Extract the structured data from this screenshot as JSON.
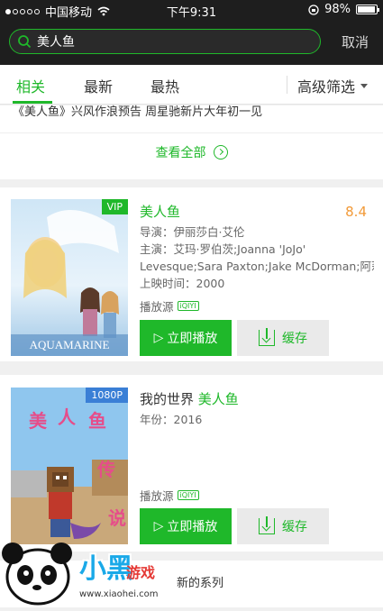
{
  "status_bar": {
    "carrier": "中国移动",
    "time": "下午9:31",
    "battery": "98%"
  },
  "search": {
    "query": "美人鱼",
    "cancel_label": "取消"
  },
  "tabs": [
    {
      "label": "相关"
    },
    {
      "label": "最新"
    },
    {
      "label": "最热"
    }
  ],
  "filter_label": "高级筛选",
  "news": {
    "text": "《美人鱼》兴风作浪预告 周星驰新片大年初一见",
    "see_all": "查看全部"
  },
  "results": [
    {
      "badge": "VIP",
      "title": "美人鱼",
      "score": "8.4",
      "director": "导演：伊丽莎白·艾伦",
      "cast_line1": "主演：艾玛·罗伯茨;Joanna 'JoJo'",
      "cast_line2": "Levesque;Sara Paxton;Jake McDorman;阿莉...",
      "release": "上映时间：2000",
      "source_label": "播放源",
      "play_label": "立即播放",
      "cache_label": "缓存",
      "poster_text": "AQUAMARINE"
    },
    {
      "badge": "1080P",
      "title_prefix": "我的世界",
      "title_highlight": "美人鱼",
      "year": "年份：2016",
      "source_label": "播放源",
      "play_label": "立即播放",
      "cache_label": "缓存",
      "poster_chars": [
        "美",
        "人",
        "鱼",
        "传",
        "说"
      ]
    }
  ],
  "footer_text": "新的系列",
  "watermark": {
    "brand": "小黑",
    "sub": "游戏",
    "url": "www.xiaohei.com"
  }
}
